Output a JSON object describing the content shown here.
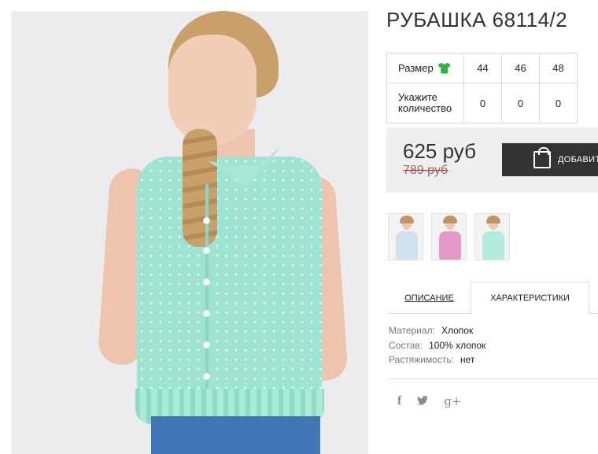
{
  "product": {
    "title": "РУБАШКА 68114/2",
    "image_alt": "mint sleeveless shirt on model"
  },
  "sizes_table": {
    "size_label": "Размер",
    "size_icon": "shirt-icon",
    "sizes": [
      "44",
      "46",
      "48"
    ],
    "qty_label_line1": "Укажите",
    "qty_label_line2": "количество",
    "quantities": [
      "0",
      "0",
      "0"
    ]
  },
  "pricing": {
    "price": "625 руб",
    "old_price": "789 руб",
    "add_to_cart_label": "ДОБАВИТ"
  },
  "thumbnails": [
    {
      "name": "thumb-blue-shirt",
      "color": "#cfe0ef"
    },
    {
      "name": "thumb-pink-shirt",
      "color": "#e59ac6"
    },
    {
      "name": "thumb-mint-shirt",
      "color": "#b6ecdf"
    }
  ],
  "tabs": {
    "description": "ОПИСАНИЕ",
    "characteristics": "ХАРАКТЕРИСТИКИ"
  },
  "specs": [
    {
      "key": "Материал:",
      "value": "Хлопок"
    },
    {
      "key": "Состав:",
      "value": "100% хлопок"
    },
    {
      "key": "Растяжимость:",
      "value": "нет"
    }
  ],
  "social": {
    "facebook": "f",
    "twitter": "🐦",
    "gplus": "g+"
  },
  "colors": {
    "dark_button": "#333333",
    "price_bg": "#efefef",
    "strike": "#e03030",
    "size_icon": "#2fb344"
  }
}
